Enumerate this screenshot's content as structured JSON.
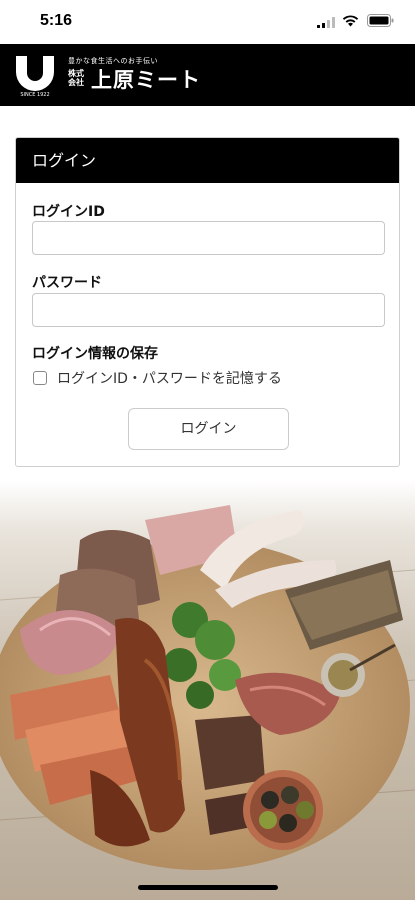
{
  "status_bar": {
    "time": "5:16"
  },
  "header": {
    "tagline": "豊かな食生活へのお手伝い",
    "corp_prefix": "株式会社",
    "brand_name": "上原ミート",
    "logo_caption": "SINCE 1922",
    "background_color": "#000000"
  },
  "login": {
    "title": "ログイン",
    "id_label": "ログインID",
    "id_value": "",
    "password_label": "パスワード",
    "password_value": "",
    "save_section_label": "ログイン情報の保存",
    "remember_label": "ログインID・パスワードを記憶する",
    "remember_checked": false,
    "submit_label": "ログイン"
  },
  "background_image": {
    "icon": "charcuterie-board-photo"
  }
}
